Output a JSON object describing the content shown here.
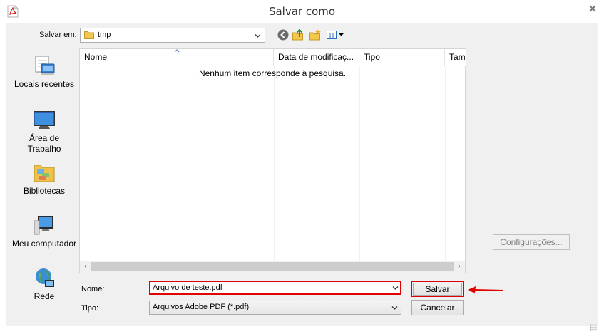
{
  "window": {
    "title": "Salvar como",
    "app_icon": "pdf-file-icon"
  },
  "location": {
    "label": "Salvar em:",
    "value": "tmp"
  },
  "toolbar": {
    "icons": [
      "back-icon",
      "up-folder-icon",
      "new-folder-icon",
      "view-menu-icon"
    ]
  },
  "places": [
    {
      "label": "Locais recentes",
      "icon": "recent-places-icon"
    },
    {
      "label": "Área de Trabalho",
      "icon": "desktop-icon"
    },
    {
      "label": "Bibliotecas",
      "icon": "libraries-icon"
    },
    {
      "label": "Meu computador",
      "icon": "computer-icon"
    },
    {
      "label": "Rede",
      "icon": "network-icon"
    }
  ],
  "file_list": {
    "columns": [
      "Nome",
      "Data de modificaç...",
      "Tipo",
      "Tam"
    ],
    "empty_message": "Nenhum item corresponde à pesquisa."
  },
  "settings_button": "Configurações...",
  "file_name": {
    "label": "Nome:",
    "value": "Arquivo de teste.pdf"
  },
  "file_type": {
    "label": "Tipo:",
    "value": "Arquivos Adobe PDF (*.pdf)"
  },
  "buttons": {
    "save": "Salvar",
    "cancel": "Cancelar"
  },
  "colors": {
    "highlight": "#e00000",
    "dialog_bg": "#f0f0f0"
  }
}
